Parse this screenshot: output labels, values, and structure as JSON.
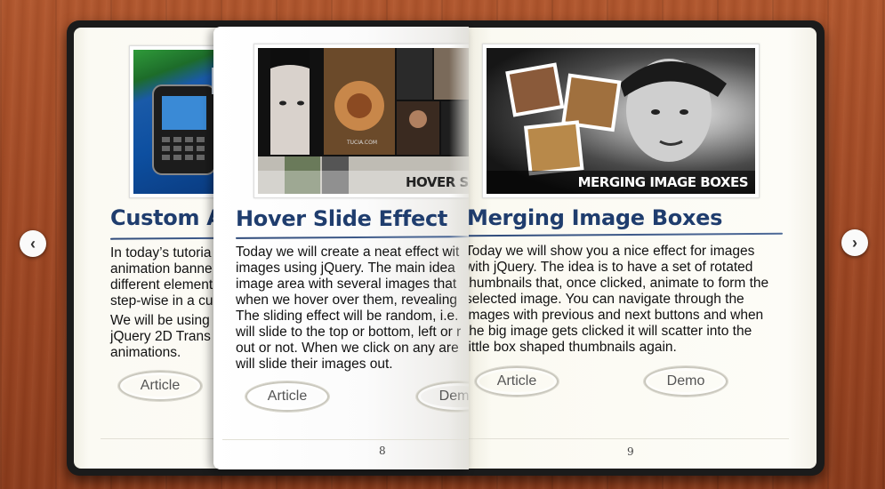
{
  "left_page": {
    "title": "Custom A",
    "paragraph1": [
      "In today’s tutoria",
      "animation banne",
      "different element",
      "step-wise in a cu"
    ],
    "paragraph2": [
      "We will be using",
      "jQuery 2D Trans",
      "animations."
    ],
    "article_label": "Article"
  },
  "flip_page": {
    "title": "Hover Slide Effect",
    "thumb_caption": "HOVER SLID",
    "thumb_watermark": "TUCIA.COM",
    "paragraph": [
      "Today we will create a neat effect wit",
      "images using jQuery. The main idea",
      "image area with several images that",
      "when we hover over them, revealing",
      "The sliding effect will be random, i.e.",
      "will slide to the top or bottom, left or r",
      "out or not. When we click on any are",
      "will slide their images out."
    ],
    "article_label": "Article",
    "demo_label": "Demo",
    "page_number": "8"
  },
  "right_page": {
    "title": "Merging Image Boxes",
    "thumb_caption": "MERGING IMAGE BOXES",
    "paragraph": [
      "Today we will show you a nice effect for images",
      "with jQuery. The idea is to have a set of rotated",
      "thumbnails that, once clicked, animate to form the",
      "selected image. You can navigate through the",
      "images with previous and next buttons and when",
      "the big image gets clicked it will scatter into the",
      "little box shaped thumbnails again."
    ],
    "article_label": "Article",
    "demo_label": "Demo",
    "page_number": "9"
  },
  "nav": {
    "prev_icon": "chevron-left-icon",
    "next_icon": "chevron-right-icon",
    "prev_glyph": "‹",
    "next_glyph": "›"
  },
  "colors": {
    "title": "#1f3d6e",
    "wood": "#9e4622",
    "book_cover": "#1b1b1b",
    "paper": "#fdfcf7"
  }
}
